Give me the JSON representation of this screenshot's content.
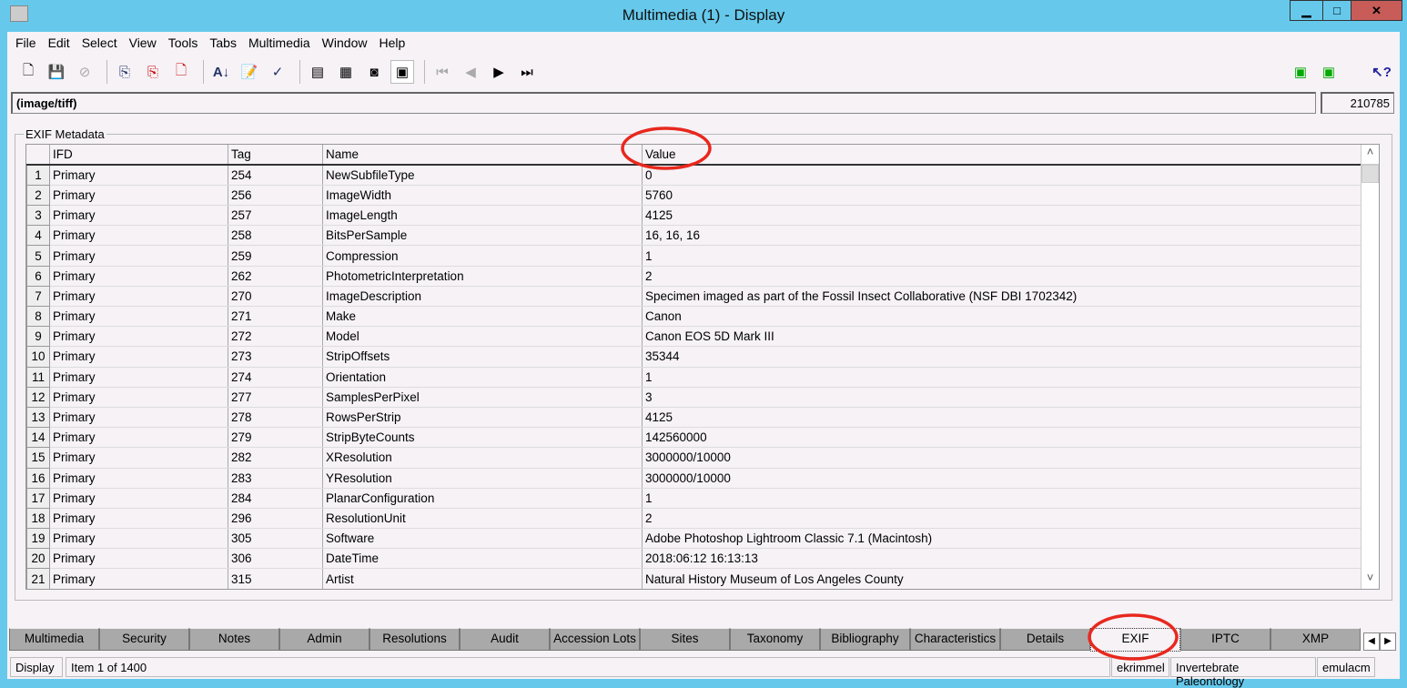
{
  "window": {
    "title": "Multimedia (1) - Display",
    "minimize": "▁",
    "maximize": "□",
    "close": "✕"
  },
  "menu": [
    "File",
    "Edit",
    "Select",
    "View",
    "Tools",
    "Tabs",
    "Multimedia",
    "Window",
    "Help"
  ],
  "toolbar_icons": [
    "new-icon",
    "save-icon",
    "cancel-icon",
    "record-icon",
    "delete-record-icon",
    "discard-icon",
    "sort-icon",
    "notepad-icon",
    "spellcheck-icon",
    "list-view-icon",
    "grid-view-icon",
    "details-view-icon",
    "page-view-icon",
    "first-icon",
    "previous-icon",
    "next-icon",
    "last-icon"
  ],
  "field": {
    "mime": "(image/tiff)",
    "irn": "210785"
  },
  "group_label": "EXIF Metadata",
  "table": {
    "columns": [
      "",
      "IFD",
      "Tag",
      "Name",
      "Value"
    ],
    "rows": [
      [
        "1",
        "Primary",
        "254",
        "NewSubfileType",
        "0"
      ],
      [
        "2",
        "Primary",
        "256",
        "ImageWidth",
        "5760"
      ],
      [
        "3",
        "Primary",
        "257",
        "ImageLength",
        "4125"
      ],
      [
        "4",
        "Primary",
        "258",
        "BitsPerSample",
        "16, 16, 16"
      ],
      [
        "5",
        "Primary",
        "259",
        "Compression",
        "1"
      ],
      [
        "6",
        "Primary",
        "262",
        "PhotometricInterpretation",
        "2"
      ],
      [
        "7",
        "Primary",
        "270",
        "ImageDescription",
        "Specimen imaged as part of the Fossil Insect Collaborative (NSF DBI 1702342)"
      ],
      [
        "8",
        "Primary",
        "271",
        "Make",
        "Canon"
      ],
      [
        "9",
        "Primary",
        "272",
        "Model",
        "Canon EOS 5D Mark III"
      ],
      [
        "10",
        "Primary",
        "273",
        "StripOffsets",
        "35344"
      ],
      [
        "11",
        "Primary",
        "274",
        "Orientation",
        "1"
      ],
      [
        "12",
        "Primary",
        "277",
        "SamplesPerPixel",
        "3"
      ],
      [
        "13",
        "Primary",
        "278",
        "RowsPerStrip",
        "4125"
      ],
      [
        "14",
        "Primary",
        "279",
        "StripByteCounts",
        "142560000"
      ],
      [
        "15",
        "Primary",
        "282",
        "XResolution",
        "3000000/10000"
      ],
      [
        "16",
        "Primary",
        "283",
        "YResolution",
        "3000000/10000"
      ],
      [
        "17",
        "Primary",
        "284",
        "PlanarConfiguration",
        "1"
      ],
      [
        "18",
        "Primary",
        "296",
        "ResolutionUnit",
        "2"
      ],
      [
        "19",
        "Primary",
        "305",
        "Software",
        "Adobe Photoshop Lightroom Classic 7.1 (Macintosh)"
      ],
      [
        "20",
        "Primary",
        "306",
        "DateTime",
        "2018:06:12 16:13:13"
      ],
      [
        "21",
        "Primary",
        "315",
        "Artist",
        "Natural History Museum of Los Angeles County"
      ]
    ]
  },
  "tabs": [
    "Multimedia",
    "Security",
    "Notes",
    "Admin",
    "Resolutions",
    "Audit",
    "Accession Lots",
    "Sites",
    "Taxonomy",
    "Bibliography",
    "Characteristics",
    "Details",
    "EXIF",
    "IPTC",
    "XMP"
  ],
  "active_tab": "EXIF",
  "status": {
    "mode": "Display",
    "item": "Item 1 of 1400",
    "user": "ekrimmel",
    "department": "Invertebrate Paleontology",
    "host": "emulacm"
  },
  "colors": {
    "titlebar": "#66c9ec",
    "close": "#c75c58",
    "annotation": "#e8281e"
  }
}
